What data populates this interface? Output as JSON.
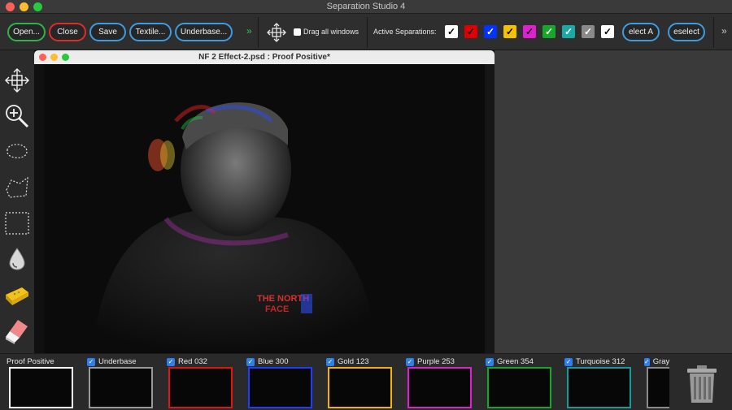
{
  "app": {
    "title": "Separation Studio 4"
  },
  "toolbar": {
    "buttons": [
      {
        "label": "Open...",
        "color": "#2fb34a"
      },
      {
        "label": "Close",
        "color": "#e02b2b"
      },
      {
        "label": "Save",
        "color": "#3d9be0"
      },
      {
        "label": "Textile...",
        "color": "#3d9be0"
      },
      {
        "label": "Underbase...",
        "color": "#3d9be0"
      }
    ],
    "overflow_chevron": "»",
    "drag_all_label": "Drag all windows",
    "active_separations_label": "Active Separations:",
    "separations": [
      {
        "color": "#ffffff",
        "check": "#000000",
        "checked": true
      },
      {
        "color": "#e00000",
        "check": "#000000",
        "checked": true
      },
      {
        "color": "#0033ff",
        "check": "#ffffff",
        "checked": true
      },
      {
        "color": "#f5c000",
        "check": "#000000",
        "checked": true
      },
      {
        "color": "#e020d0",
        "check": "#000000",
        "checked": true
      },
      {
        "color": "#16a829",
        "check": "#ffffff",
        "checked": true
      },
      {
        "color": "#1aa9a5",
        "check": "#ffffff",
        "checked": true
      },
      {
        "color": "#8a8a8a",
        "check": "#ffffff",
        "checked": true
      },
      {
        "color": "#ffffff",
        "check": "#000000",
        "checked": true
      }
    ],
    "select_all_label": "elect A",
    "deselect_label": "eselect"
  },
  "tools": [
    {
      "icon": "move-icon"
    },
    {
      "icon": "zoom-icon"
    },
    {
      "icon": "lasso-icon"
    },
    {
      "icon": "polygon-lasso-icon"
    },
    {
      "icon": "rectangle-select-icon"
    },
    {
      "icon": "eyedropper-icon"
    },
    {
      "icon": "sponge-icon"
    },
    {
      "icon": "eraser-icon"
    }
  ],
  "document": {
    "title": "NF 2 Effect-2.psd : Proof Positive*",
    "shirt_text": [
      "THE NORTH",
      "FACE"
    ]
  },
  "thumbnails": [
    {
      "label": "Proof Positive",
      "checked": false,
      "color": "#ffffff"
    },
    {
      "label": "Underbase",
      "checked": true,
      "color": "#9a9a9a"
    },
    {
      "label": "Red 032",
      "checked": true,
      "color": "#e01414"
    },
    {
      "label": "Blue 300",
      "checked": true,
      "color": "#1f3dff"
    },
    {
      "label": "Gold 123",
      "checked": true,
      "color": "#f2b400"
    },
    {
      "label": "Purple 253",
      "checked": true,
      "color": "#e020d0"
    },
    {
      "label": "Green 354",
      "checked": true,
      "color": "#14a82a"
    },
    {
      "label": "Turquoise 312",
      "checked": true,
      "color": "#169b98"
    },
    {
      "label": "Gray",
      "checked": true,
      "color": "#8a8a8a"
    }
  ]
}
